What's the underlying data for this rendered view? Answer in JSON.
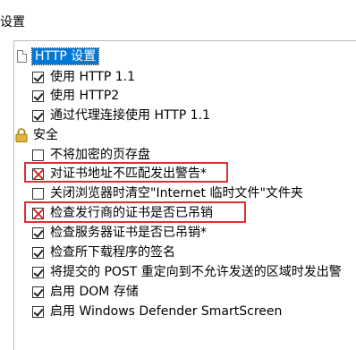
{
  "header": {
    "title": "设置"
  },
  "groups": [
    {
      "label": "HTTP 设置",
      "icon": "page-icon",
      "items": [
        {
          "label": "使用 HTTP 1.1",
          "checked": true
        },
        {
          "label": "使用 HTTP2",
          "checked": true
        },
        {
          "label": "通过代理连接使用 HTTP 1.1",
          "checked": true
        }
      ]
    },
    {
      "label": "安全",
      "icon": "lock-icon",
      "items": [
        {
          "label": "不将加密的页存盘",
          "checked": false
        },
        {
          "label": "对证书地址不匹配发出警告*",
          "checked": false,
          "crossed": true
        },
        {
          "label": "关闭浏览器时清空\"Internet 临时文件\"文件夹",
          "checked": false
        },
        {
          "label": "检查发行商的证书是否已吊销",
          "checked": false,
          "crossed": true
        },
        {
          "label": "检查服务器证书是否已吊销*",
          "checked": true
        },
        {
          "label": "检查所下载程序的签名",
          "checked": true
        },
        {
          "label": "将提交的 POST 重定向到不允许发送的区域时发出警",
          "checked": true
        },
        {
          "label": "启用 DOM 存储",
          "checked": true
        },
        {
          "label": "启用 Windows Defender SmartScreen",
          "checked": true
        }
      ]
    }
  ],
  "colors": {
    "selection": "#0078d7",
    "highlight": "#e03131"
  }
}
